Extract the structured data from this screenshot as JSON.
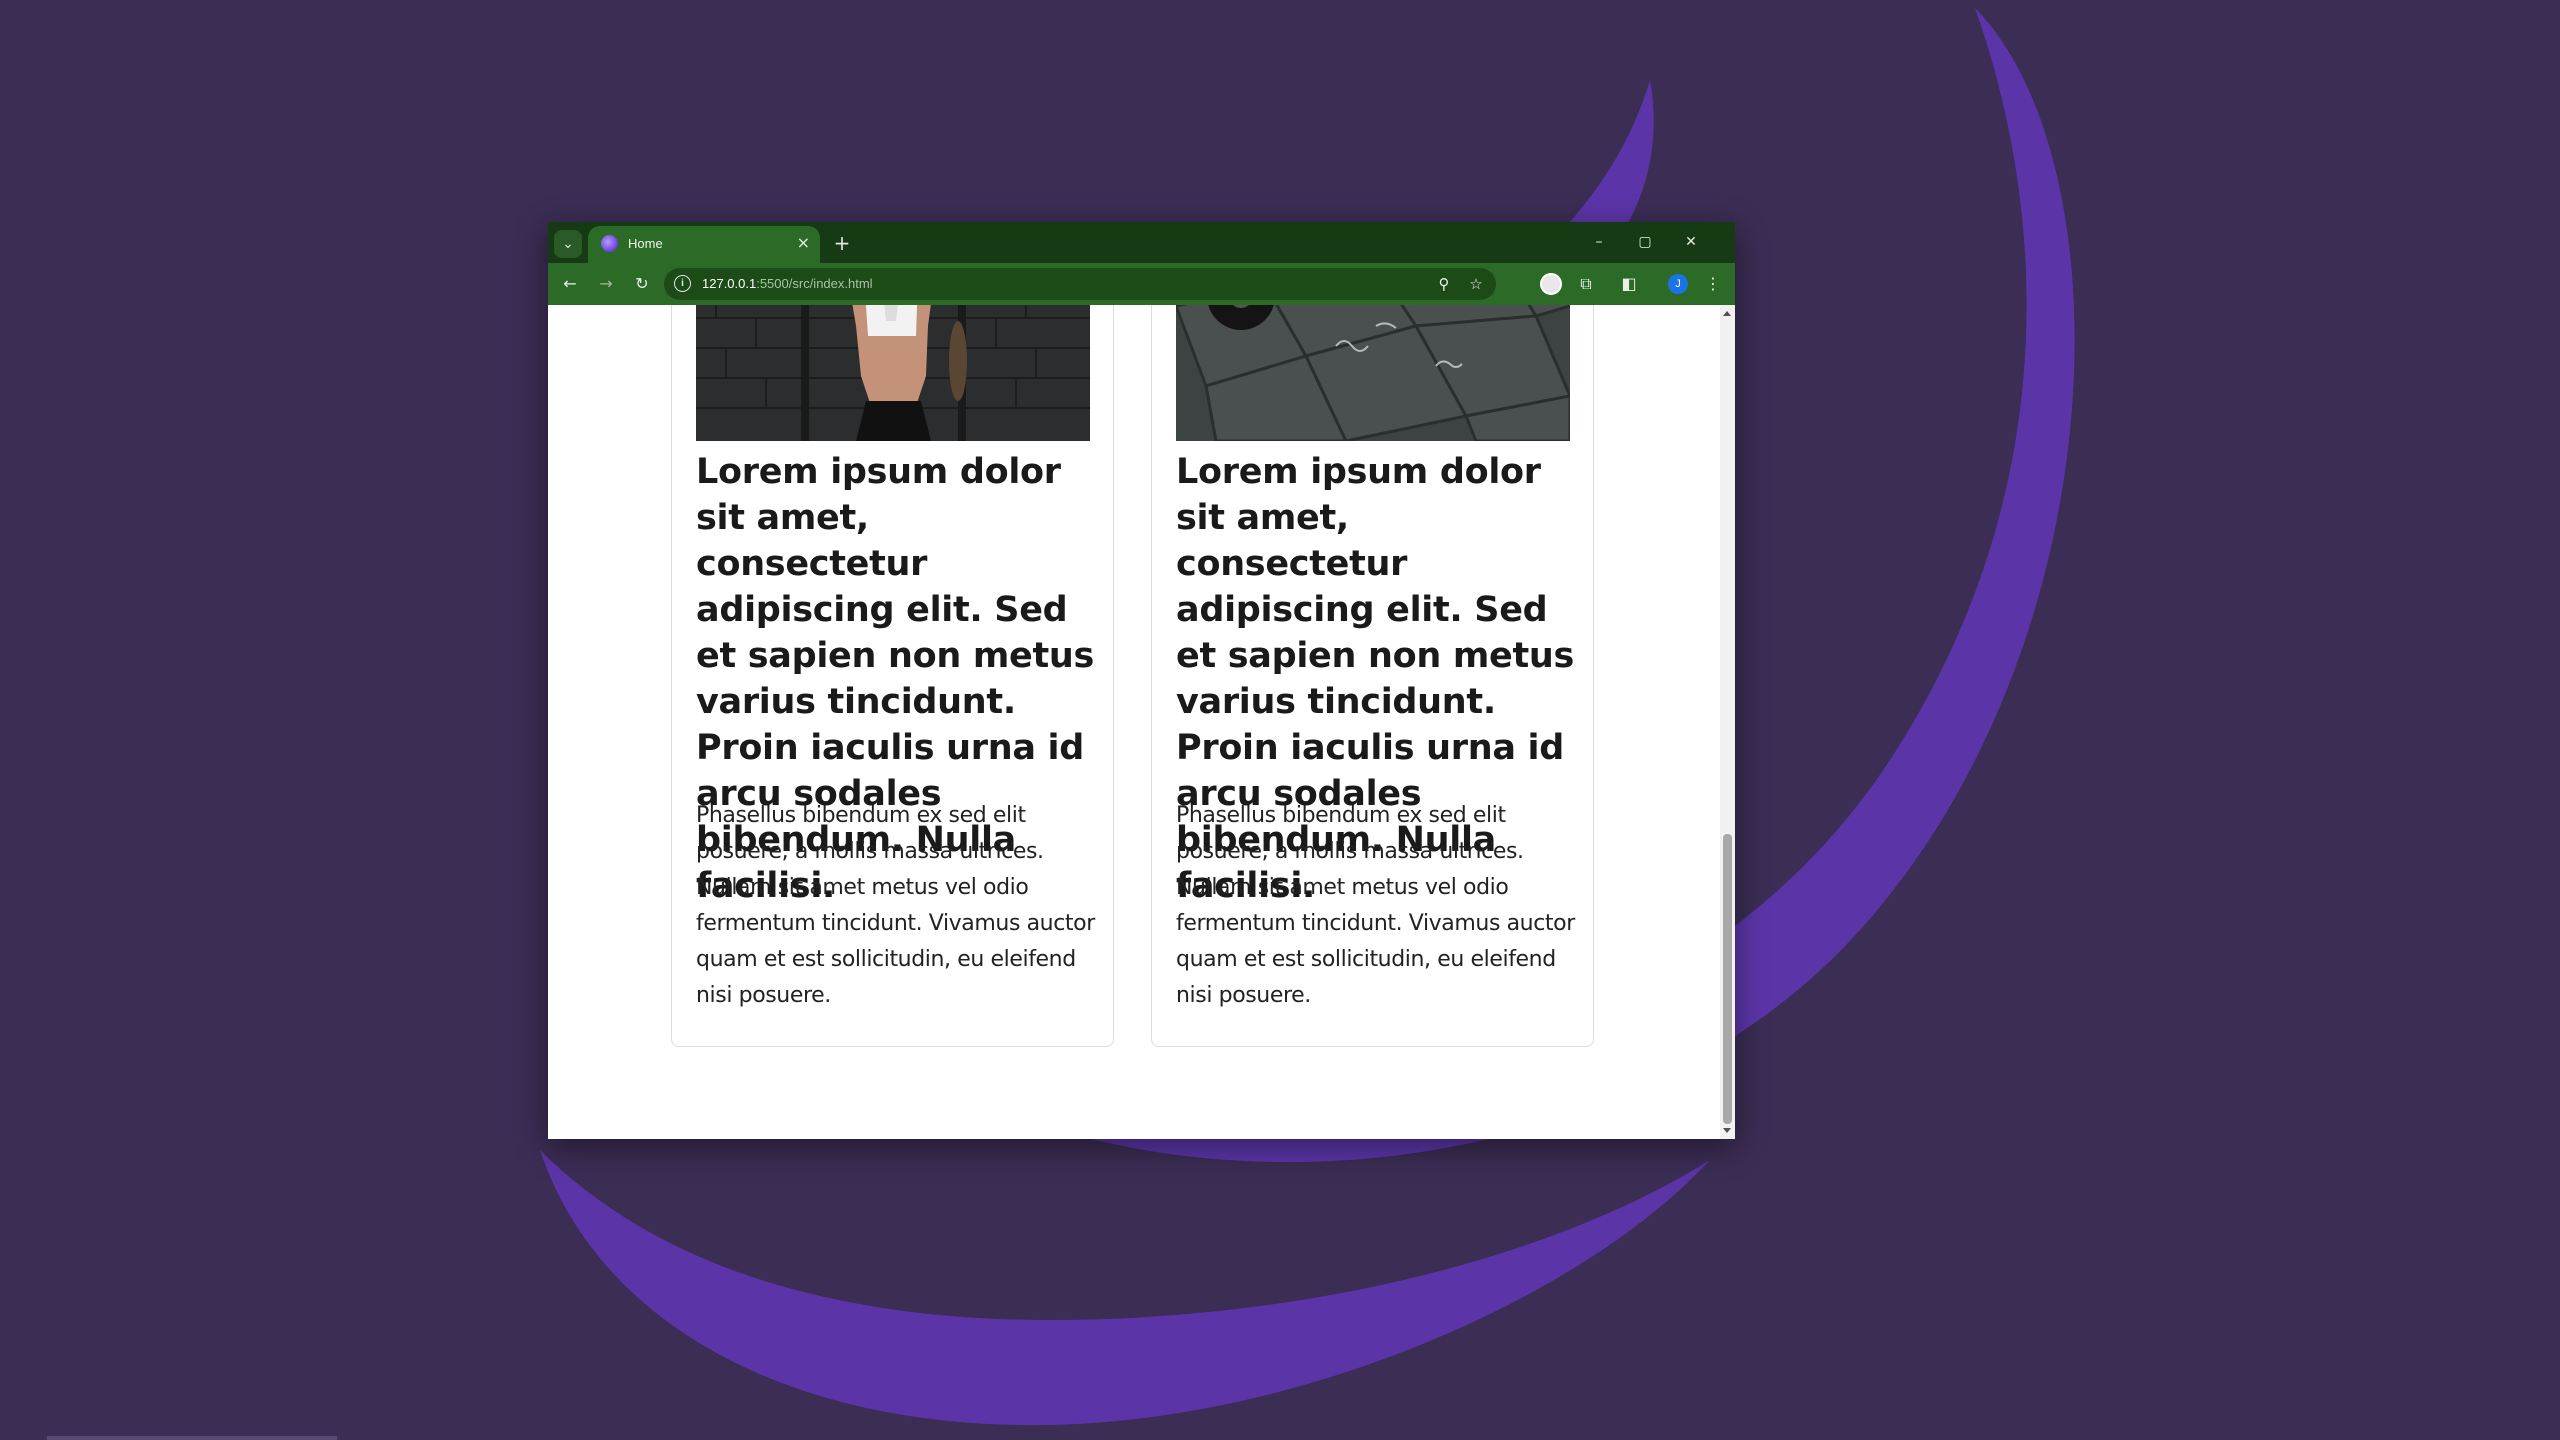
{
  "browser": {
    "tab_title": "Home",
    "url_host": "127.0.0.1",
    "url_rest": ":5500/src/index.html"
  },
  "icons": {
    "tab_search": "chevron-down-icon",
    "tab_close": "close-icon",
    "new_tab": "plus-icon",
    "back": "arrow-left-icon",
    "forward": "arrow-right-icon",
    "reload": "reload-icon",
    "site_info": "info-icon",
    "zoom": "zoom-icon",
    "bookmark": "star-icon",
    "extensions": "puzzle-icon",
    "side_panel": "side-panel-icon",
    "menu": "kebab-menu-icon"
  },
  "profile": {
    "initial": "J"
  },
  "cards": [
    {
      "title": "Lorem ipsum dolor sit amet, consectetur adipiscing elit. Sed et sapien non metus varius tincidunt. Proin iaculis urna id arcu sodales bibendum. Nulla facilisi.",
      "text": "Phasellus bibendum ex sed elit posuere, a mollis massa ultrices. Nullam sit amet metus vel odio fermentum tincidunt. Vivamus auctor quam et est sollicitudin, eu eleifend nisi posuere."
    },
    {
      "title": "Lorem ipsum dolor sit amet, consectetur adipiscing elit. Sed et sapien non metus varius tincidunt. Proin iaculis urna id arcu sodales bibendum. Nulla facilisi.",
      "text": "Phasellus bibendum ex sed elit posuere, a mollis massa ultrices. Nullam sit amet metus vel odio fermentum tincidunt. Vivamus auctor quam et est sollicitudin, eu eleifend nisi posuere."
    }
  ],
  "colors": {
    "desktop_bg": "#3b2d54",
    "wallpaper_accent": "#5b35a8",
    "titlebar": "#163a13",
    "toolbar": "#2c6b27"
  }
}
